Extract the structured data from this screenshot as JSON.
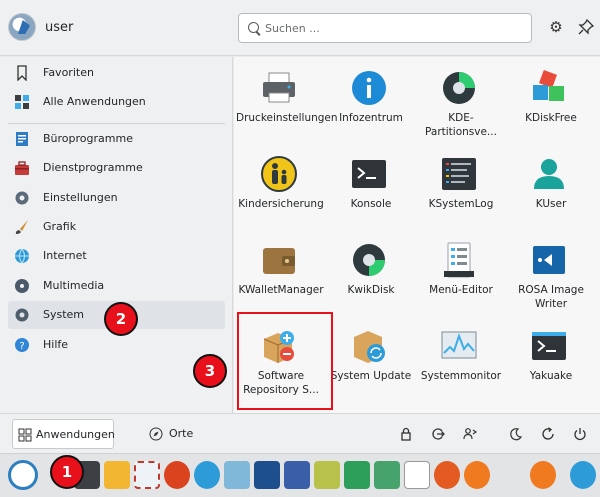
{
  "header": {
    "username": "user",
    "search_placeholder": "Suchen ...",
    "configure_icon": "gear-icon",
    "pin_icon": "pin-icon"
  },
  "sidebar": {
    "items": [
      {
        "label": "Favoriten",
        "icon": "bookmark-icon"
      },
      {
        "label": "Alle Anwendungen",
        "icon": "grid-icon"
      },
      {
        "label": "Büroprogramme",
        "icon": "office-icon"
      },
      {
        "label": "Dienstprogramme",
        "icon": "toolbox-icon"
      },
      {
        "label": "Einstellungen",
        "icon": "settings-icon"
      },
      {
        "label": "Grafik",
        "icon": "brush-icon"
      },
      {
        "label": "Internet",
        "icon": "globe-icon"
      },
      {
        "label": "Multimedia",
        "icon": "music-icon"
      },
      {
        "label": "System",
        "icon": "system-gear-icon",
        "selected": true
      },
      {
        "label": "Hilfe",
        "icon": "help-icon"
      }
    ]
  },
  "apps": [
    {
      "label": "Druckeinstellungen",
      "icon": "printer-icon"
    },
    {
      "label": "Infozentrum",
      "icon": "info-icon"
    },
    {
      "label": "KDE-Partitionsve...",
      "icon": "partition-icon"
    },
    {
      "label": "KDiskFree",
      "icon": "diskfree-icon"
    },
    {
      "label": "Kindersicherung",
      "icon": "parental-control-icon"
    },
    {
      "label": "Konsole",
      "icon": "terminal-icon"
    },
    {
      "label": "KSystemLog",
      "icon": "log-icon"
    },
    {
      "label": "KUser",
      "icon": "user-icon"
    },
    {
      "label": "KWalletManager",
      "icon": "wallet-icon"
    },
    {
      "label": "KwikDisk",
      "icon": "disk-icon"
    },
    {
      "label": "Menü-Editor",
      "icon": "menu-editor-icon"
    },
    {
      "label": "ROSA Image Writer",
      "icon": "image-writer-icon"
    },
    {
      "label": "Software Repository S...",
      "icon": "software-repo-icon"
    },
    {
      "label": "System Update",
      "icon": "system-update-icon"
    },
    {
      "label": "Systemmonitor",
      "icon": "system-monitor-icon"
    },
    {
      "label": "Yakuake",
      "icon": "dropdown-terminal-icon"
    }
  ],
  "footer": {
    "applications_tab": "Anwendungen",
    "places_tab": "Orte",
    "lock_icon": "lock-icon",
    "logout_icon": "logout-icon",
    "switch_user_icon": "switch-user-icon",
    "sleep_icon": "sleep-icon",
    "restart_icon": "restart-icon",
    "shutdown_icon": "shutdown-icon"
  },
  "markers": [
    "1",
    "2",
    "3"
  ],
  "colors": {
    "accent": "#3daee9",
    "marker": "#e8101b",
    "selected_bg": "#dfe3e8"
  }
}
